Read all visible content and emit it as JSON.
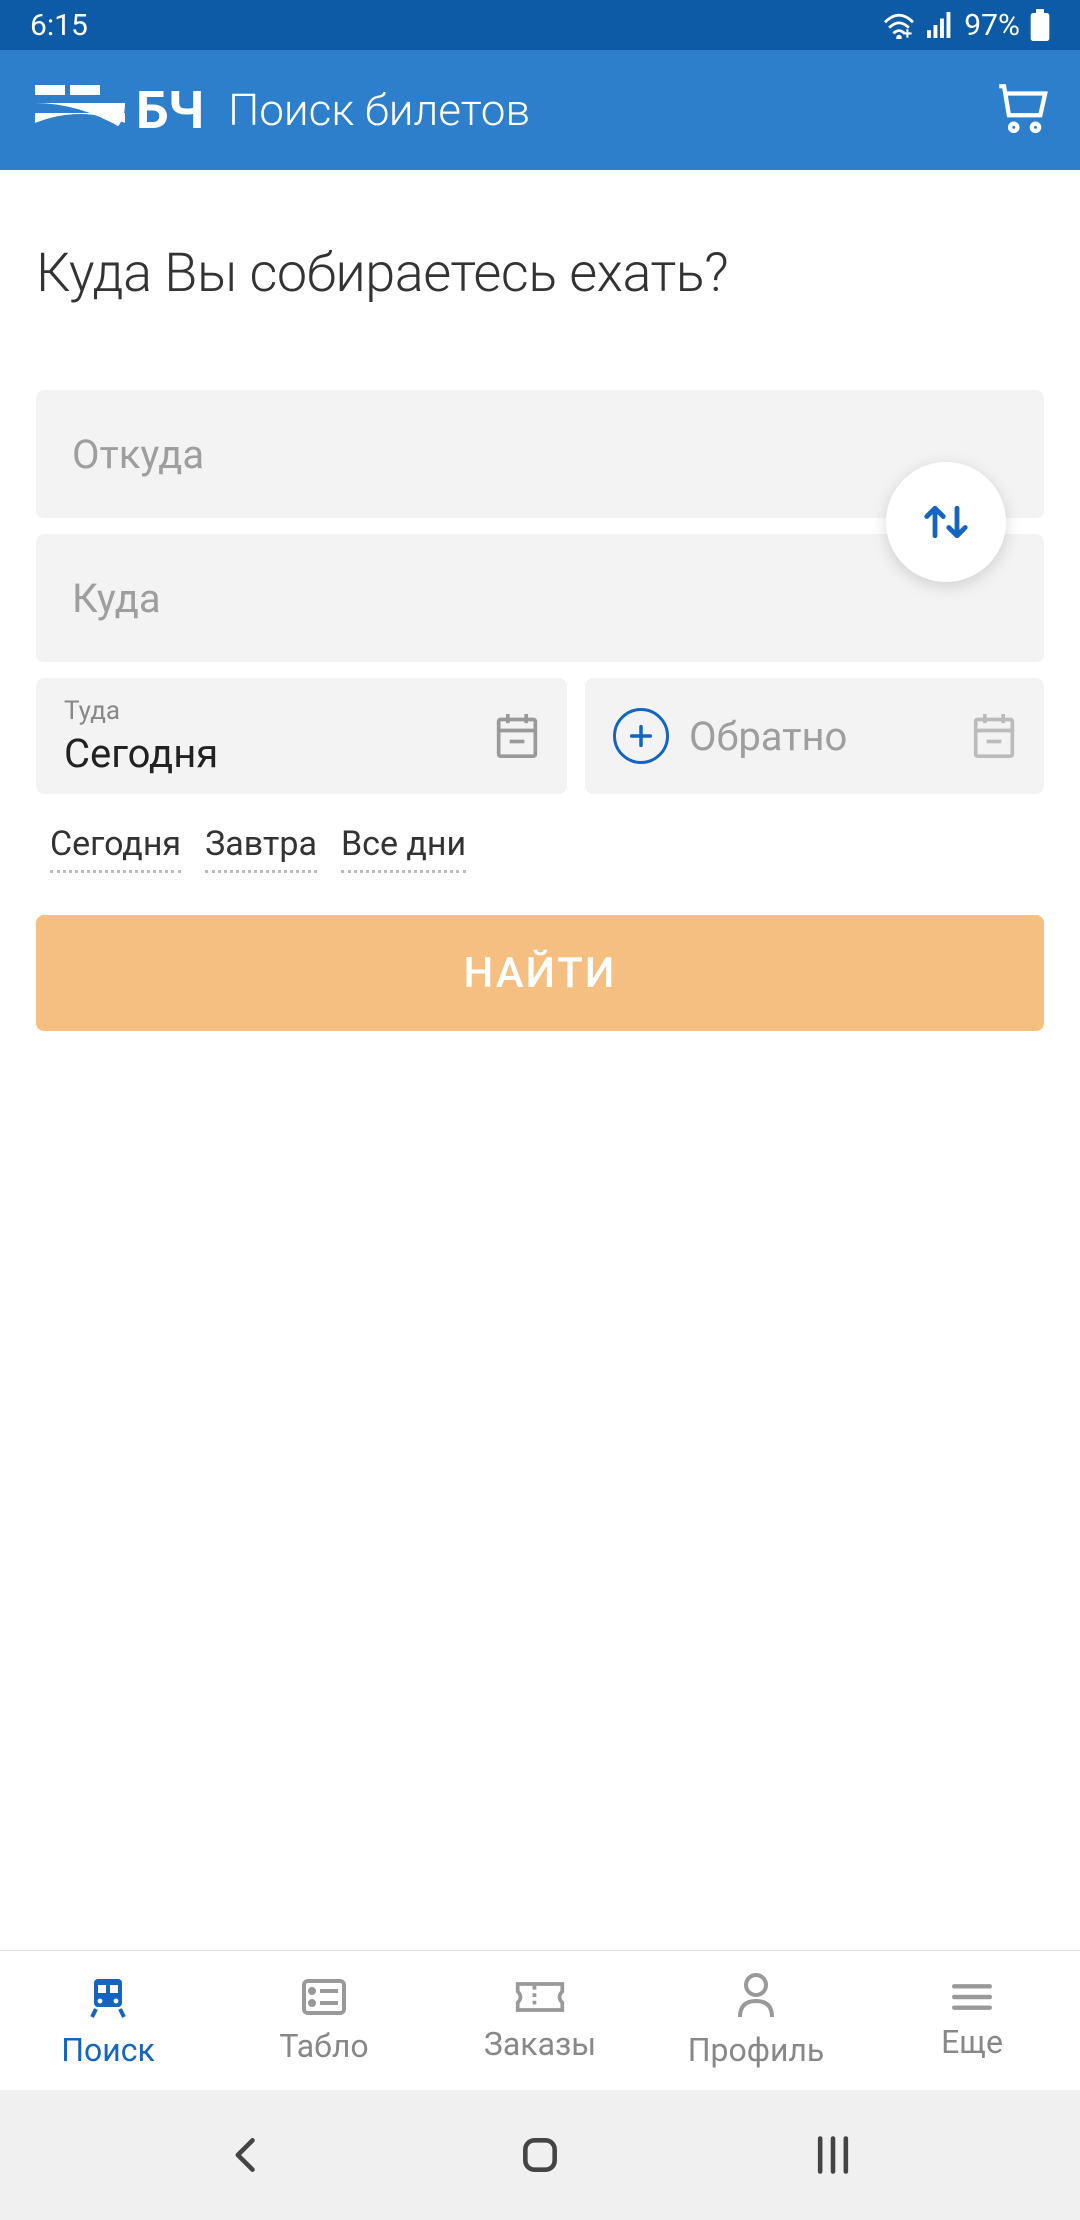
{
  "statusBar": {
    "time": "6:15",
    "battery": "97%"
  },
  "header": {
    "logoLabel": "БЧ",
    "title": "Поиск билетов"
  },
  "main": {
    "heading": "Куда Вы собираетесь ехать?",
    "fromPlaceholder": "Откуда",
    "toPlaceholder": "Куда",
    "departDate": {
      "label": "Туда",
      "value": "Сегодня"
    },
    "returnDate": {
      "placeholder": "Обратно"
    },
    "quickDates": {
      "today": "Сегодня",
      "tomorrow": "Завтра",
      "allDays": "Все дни"
    },
    "searchButton": "НАЙТИ"
  },
  "bottomNav": {
    "search": "Поиск",
    "board": "Табло",
    "orders": "Заказы",
    "profile": "Профиль",
    "more": "Еще"
  }
}
